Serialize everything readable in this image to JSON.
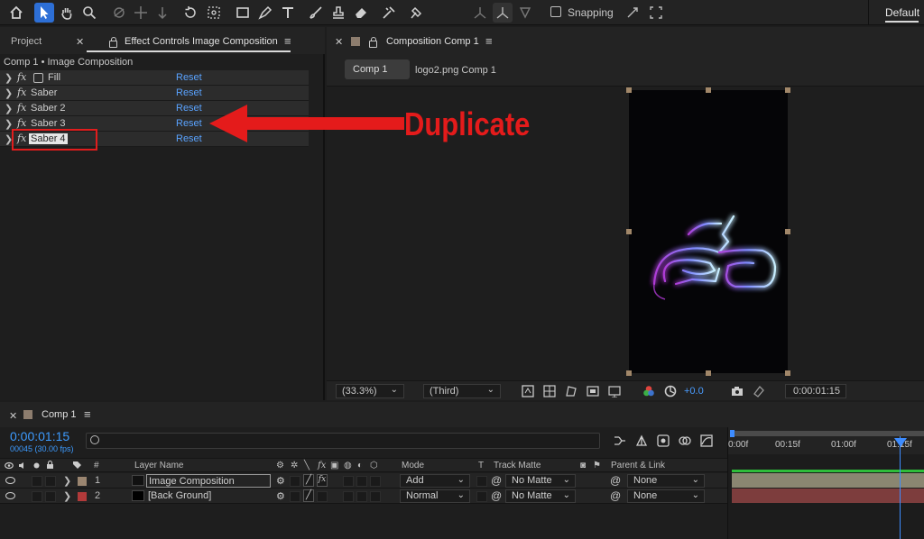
{
  "toolbar": {
    "tools": [
      "home-icon",
      "selection-icon",
      "hand-icon",
      "zoom-icon",
      "orbit-icon",
      "pan-icon",
      "dolly-icon",
      "rotate-icon",
      "anchor-icon",
      "rectangle-icon",
      "pen-icon",
      "type-icon",
      "brush-icon",
      "clone-stamp-icon",
      "eraser-icon",
      "roto-brush-icon",
      "puppet-icon"
    ],
    "active_tool": "selection-icon",
    "snapping_label": "Snapping",
    "workspace_label": "Default"
  },
  "left_panel": {
    "tab_project": "Project",
    "tab_effect_controls": "Effect Controls Image Composition",
    "breadcrumb": "Comp 1 • Image Composition",
    "effects": [
      {
        "name": "Fill",
        "reset": "Reset"
      },
      {
        "name": "Saber",
        "reset": "Reset"
      },
      {
        "name": "Saber 2",
        "reset": "Reset"
      },
      {
        "name": "Saber 3",
        "reset": "Reset"
      },
      {
        "name": "Saber 4",
        "reset": "Reset"
      }
    ],
    "fx_glyph": "fx"
  },
  "annotation": {
    "label": "Duplicate",
    "color": "#e41b1b"
  },
  "composition": {
    "tab_label": "Composition Comp 1",
    "comp_button": "Comp 1",
    "next_comp": "logo2.png Comp 1",
    "zoom": "(33.3%)",
    "resolution": "(Third)",
    "exposure": "+0.0",
    "timecode": "0:00:01:15"
  },
  "timeline": {
    "tab_label": "Comp 1",
    "timecode": "0:00:01:15",
    "frames": "00045 (30.00 fps)",
    "ruler": [
      "0:00f",
      "00:15f",
      "01:00f",
      "01:15f"
    ],
    "columns": {
      "num": "#",
      "layer_name": "Layer Name",
      "mode": "Mode",
      "t": "T",
      "track_matte": "Track Matte",
      "parent": "Parent & Link"
    },
    "layers": [
      {
        "num": "1",
        "name": "Image Composition",
        "mode": "Add",
        "matte": "No Matte",
        "parent": "None",
        "label_color": "#9a8570"
      },
      {
        "num": "2",
        "name": "[Back Ground]",
        "mode": "Normal",
        "matte": "No Matte",
        "parent": "None",
        "label_color": "#b23a3a"
      }
    ]
  }
}
